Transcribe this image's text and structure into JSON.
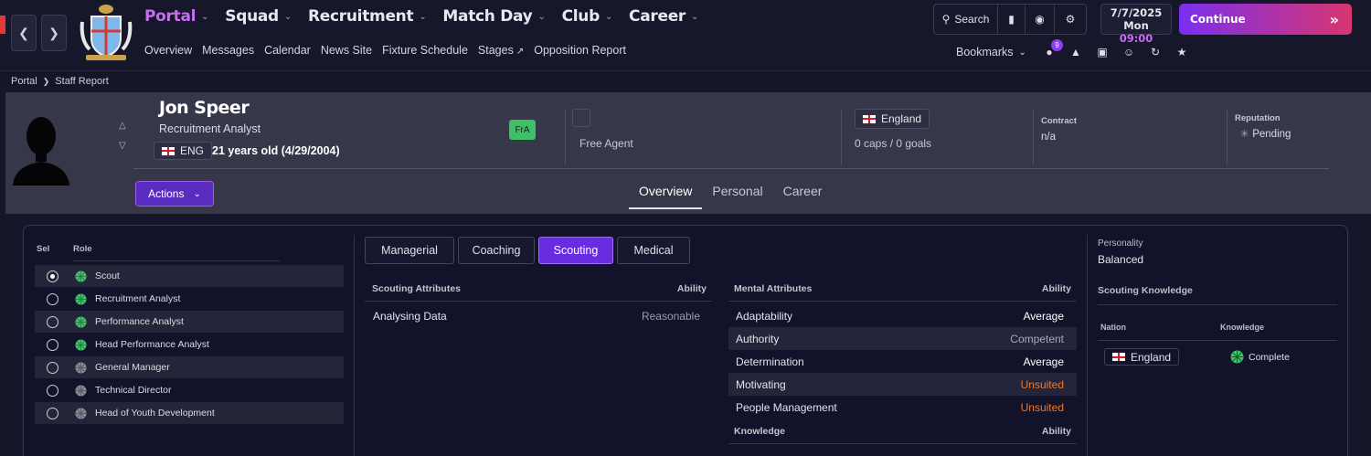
{
  "nav": {
    "main": [
      {
        "label": "Portal",
        "active": true
      },
      {
        "label": "Squad",
        "active": false
      },
      {
        "label": "Recruitment",
        "active": false
      },
      {
        "label": "Match Day",
        "active": false
      },
      {
        "label": "Club",
        "active": false
      },
      {
        "label": "Career",
        "active": false
      }
    ],
    "sub": [
      "Overview",
      "Messages",
      "Calendar",
      "News Site",
      "Fixture Schedule",
      "Stages",
      "Opposition Report"
    ],
    "search_label": "Search",
    "bookmarks_label": "Bookmarks",
    "messages_count": "9"
  },
  "date": {
    "date": "7/7/2025",
    "day": "Mon",
    "time": "09:00"
  },
  "continue_label": "Continue",
  "breadcrumb": {
    "root": "Portal",
    "current": "Staff Report"
  },
  "profile": {
    "name": "Jon Speer",
    "role": "Recruitment Analyst",
    "nationality_code": "ENG",
    "age": "21 years old (4/29/2004)",
    "badge": "FrA",
    "club_status": "Free Agent",
    "nation": "England",
    "caps": "0 caps / 0 goals",
    "contract_label": "Contract",
    "contract_value": "n/a",
    "reputation_label": "Reputation",
    "reputation_value": "Pending",
    "actions_label": "Actions",
    "tabs": [
      {
        "label": "Overview",
        "active": true
      },
      {
        "label": "Personal",
        "active": false
      },
      {
        "label": "Career",
        "active": false
      }
    ]
  },
  "roles": {
    "sel_header": "Sel",
    "role_header": "Role",
    "items": [
      {
        "label": "Scout",
        "selected": true,
        "rating_color": "#3ec46a"
      },
      {
        "label": "Recruitment Analyst",
        "selected": false,
        "rating_color": "#3ec46a"
      },
      {
        "label": "Performance Analyst",
        "selected": false,
        "rating_color": "#3ec46a"
      },
      {
        "label": "Head Performance Analyst",
        "selected": false,
        "rating_color": "#3ec46a"
      },
      {
        "label": "General Manager",
        "selected": false,
        "rating_color": "#8a8a98"
      },
      {
        "label": "Technical Director",
        "selected": false,
        "rating_color": "#8a8a98"
      },
      {
        "label": "Head of Youth Development",
        "selected": false,
        "rating_color": "#8a8a98"
      }
    ]
  },
  "attr_tabs": [
    {
      "label": "Managerial",
      "active": false
    },
    {
      "label": "Coaching",
      "active": false
    },
    {
      "label": "Scouting",
      "active": true
    },
    {
      "label": "Medical",
      "active": false
    }
  ],
  "scouting": {
    "header": "Scouting Attributes",
    "ability_header": "Ability",
    "rows": [
      {
        "name": "Analysing Data",
        "value": "Reasonable",
        "tone": "reas"
      }
    ]
  },
  "mental": {
    "header": "Mental Attributes",
    "ability_header": "Ability",
    "rows": [
      {
        "name": "Adaptability",
        "value": "Average",
        "tone": "avg"
      },
      {
        "name": "Authority",
        "value": "Competent",
        "tone": "comp"
      },
      {
        "name": "Determination",
        "value": "Average",
        "tone": "avg"
      },
      {
        "name": "Motivating",
        "value": "Unsuited",
        "tone": "uns"
      },
      {
        "name": "People Management",
        "value": "Unsuited",
        "tone": "uns"
      }
    ]
  },
  "knowledge": {
    "header": "Knowledge",
    "ability_header": "Ability"
  },
  "right_panel": {
    "personality_label": "Personality",
    "personality_value": "Balanced",
    "scouting_knowledge_header": "Scouting Knowledge",
    "nation_header": "Nation",
    "knowledge_header": "Knowledge",
    "rows": [
      {
        "nation": "England",
        "knowledge": "Complete"
      }
    ]
  },
  "colors": {
    "accent": "#6a2ce0",
    "highlight": "#c86cf0",
    "unsuited": "#ee7a2a",
    "good": "#3ec46a"
  }
}
